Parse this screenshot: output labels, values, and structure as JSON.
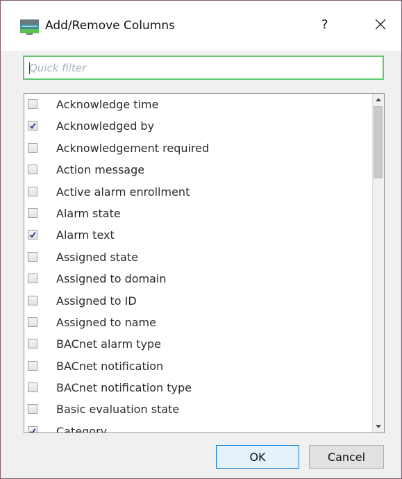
{
  "dialog": {
    "title": "Add/Remove Columns",
    "help_label": "?",
    "close_icon": "close-icon",
    "app_icon": "app-window-icon"
  },
  "filter": {
    "placeholder": "Quick filter",
    "value": ""
  },
  "columns": {
    "items": [
      {
        "label": "Acknowledge time",
        "checked": false
      },
      {
        "label": "Acknowledged by",
        "checked": true
      },
      {
        "label": "Acknowledgement required",
        "checked": false
      },
      {
        "label": "Action message",
        "checked": false
      },
      {
        "label": "Active alarm enrollment",
        "checked": false
      },
      {
        "label": "Alarm state",
        "checked": false
      },
      {
        "label": "Alarm text",
        "checked": true
      },
      {
        "label": "Assigned state",
        "checked": false
      },
      {
        "label": "Assigned to domain",
        "checked": false
      },
      {
        "label": "Assigned to ID",
        "checked": false
      },
      {
        "label": "Assigned to name",
        "checked": false
      },
      {
        "label": "BACnet alarm type",
        "checked": false
      },
      {
        "label": "BACnet notification",
        "checked": false
      },
      {
        "label": "BACnet notification type",
        "checked": false
      },
      {
        "label": "Basic evaluation state",
        "checked": false
      },
      {
        "label": "Category",
        "checked": true
      }
    ]
  },
  "footer": {
    "ok_label": "OK",
    "cancel_label": "Cancel"
  },
  "colors": {
    "focus_border": "#62c774",
    "ok_border": "#0078d7",
    "window_border": "#7b5a6a"
  }
}
